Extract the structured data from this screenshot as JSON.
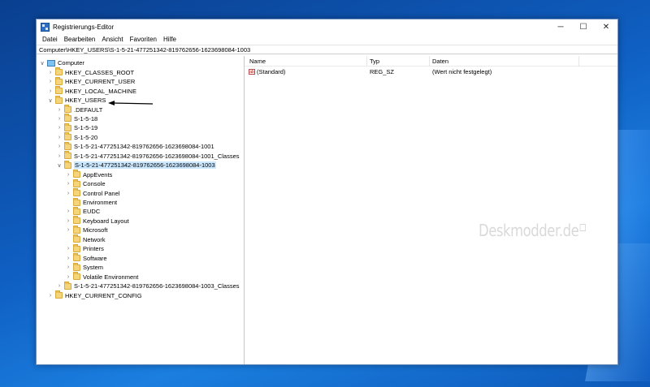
{
  "window": {
    "title": "Registrierungs-Editor",
    "minimize_glyph": "─",
    "maximize_glyph": "☐",
    "close_glyph": "✕"
  },
  "menu": [
    "Datei",
    "Bearbeiten",
    "Ansicht",
    "Favoriten",
    "Hilfe"
  ],
  "address": "Computer\\HKEY_USERS\\S-1-5-21-477251342-819762656-1623698084-1003",
  "tree": [
    {
      "label": "Computer",
      "indent": 0,
      "chevron": "∨",
      "icon": "computer-icon"
    },
    {
      "label": "HKEY_CLASSES_ROOT",
      "indent": 1,
      "chevron": "›",
      "icon": "folder-icon"
    },
    {
      "label": "HKEY_CURRENT_USER",
      "indent": 1,
      "chevron": "›",
      "icon": "folder-icon"
    },
    {
      "label": "HKEY_LOCAL_MACHINE",
      "indent": 1,
      "chevron": "›",
      "icon": "folder-icon"
    },
    {
      "label": "HKEY_USERS",
      "indent": 1,
      "chevron": "∨",
      "icon": "folder-icon"
    },
    {
      "label": ".DEFAULT",
      "indent": 2,
      "chevron": "›",
      "icon": "folder-icon"
    },
    {
      "label": "S-1-5-18",
      "indent": 2,
      "chevron": "›",
      "icon": "folder-icon"
    },
    {
      "label": "S-1-5-19",
      "indent": 2,
      "chevron": "›",
      "icon": "folder-icon"
    },
    {
      "label": "S-1-5-20",
      "indent": 2,
      "chevron": "›",
      "icon": "folder-icon"
    },
    {
      "label": "S-1-5-21-477251342-819762656-1623698084-1001",
      "indent": 2,
      "chevron": "›",
      "icon": "folder-icon"
    },
    {
      "label": "S-1-5-21-477251342-819762656-1623698084-1001_Classes",
      "indent": 2,
      "chevron": "›",
      "icon": "folder-icon"
    },
    {
      "label": "S-1-5-21-477251342-819762656-1623698084-1003",
      "indent": 2,
      "chevron": "∨",
      "icon": "folder-icon",
      "selected": true
    },
    {
      "label": "AppEvents",
      "indent": 3,
      "chevron": "›",
      "icon": "folder-icon"
    },
    {
      "label": "Console",
      "indent": 3,
      "chevron": "›",
      "icon": "folder-icon"
    },
    {
      "label": "Control Panel",
      "indent": 3,
      "chevron": "›",
      "icon": "folder-icon"
    },
    {
      "label": "Environment",
      "indent": 3,
      "chevron": "",
      "icon": "folder-icon"
    },
    {
      "label": "EUDC",
      "indent": 3,
      "chevron": "›",
      "icon": "folder-icon"
    },
    {
      "label": "Keyboard Layout",
      "indent": 3,
      "chevron": "›",
      "icon": "folder-icon"
    },
    {
      "label": "Microsoft",
      "indent": 3,
      "chevron": "›",
      "icon": "folder-icon"
    },
    {
      "label": "Network",
      "indent": 3,
      "chevron": "",
      "icon": "folder-icon"
    },
    {
      "label": "Printers",
      "indent": 3,
      "chevron": "›",
      "icon": "folder-icon"
    },
    {
      "label": "Software",
      "indent": 3,
      "chevron": "›",
      "icon": "folder-icon"
    },
    {
      "label": "System",
      "indent": 3,
      "chevron": "›",
      "icon": "folder-icon"
    },
    {
      "label": "Volatile Environment",
      "indent": 3,
      "chevron": "›",
      "icon": "folder-icon"
    },
    {
      "label": "S-1-5-21-477251342-819762656-1623698084-1003_Classes",
      "indent": 2,
      "chevron": "›",
      "icon": "folder-icon"
    },
    {
      "label": "HKEY_CURRENT_CONFIG",
      "indent": 1,
      "chevron": "›",
      "icon": "folder-icon"
    }
  ],
  "columns": {
    "name": "Name",
    "type": "Typ",
    "data": "Daten"
  },
  "values": [
    {
      "name": "(Standard)",
      "type": "REG_SZ",
      "data": "(Wert nicht festgelegt)",
      "icon": "ab-string-icon",
      "icon_text": "ab"
    }
  ],
  "watermark": "Deskmodder.de"
}
